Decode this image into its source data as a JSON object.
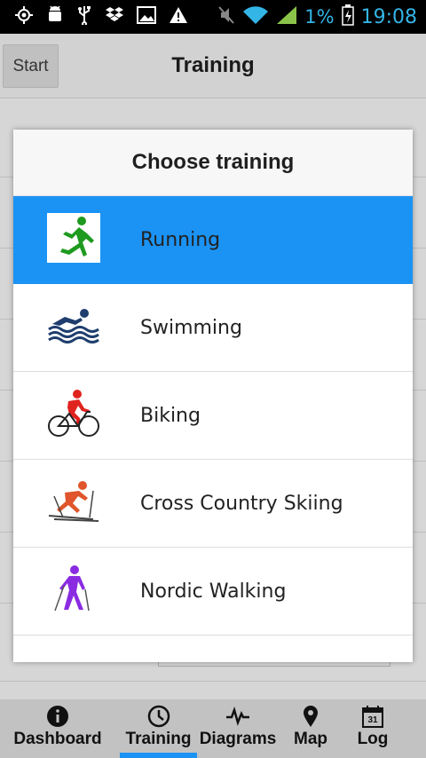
{
  "status_bar": {
    "battery_percent": "1%",
    "time": "19:08",
    "icons": [
      "gps-icon",
      "android-debug-icon",
      "usb-icon",
      "dropbox-icon",
      "image-icon",
      "warning-icon",
      "mute-icon",
      "wifi-icon",
      "signal-icon",
      "battery-icon"
    ]
  },
  "header": {
    "start_label": "Start",
    "title": "Training"
  },
  "dialog": {
    "title": "Choose training",
    "options": [
      {
        "label": "Running",
        "icon": "running-icon",
        "selected": true
      },
      {
        "label": "Swimming",
        "icon": "swimming-icon",
        "selected": false
      },
      {
        "label": "Biking",
        "icon": "biking-icon",
        "selected": false
      },
      {
        "label": "Cross Country Skiing",
        "icon": "skiing-icon",
        "selected": false
      },
      {
        "label": "Nordic Walking",
        "icon": "nordic-walking-icon",
        "selected": false
      }
    ]
  },
  "tabs": [
    {
      "label": "Dashboard",
      "icon": "info-icon",
      "active": false
    },
    {
      "label": "Training",
      "icon": "clock-icon",
      "active": true
    },
    {
      "label": "Diagrams",
      "icon": "pulse-icon",
      "active": false
    },
    {
      "label": "Map",
      "icon": "map-pin-icon",
      "active": false
    },
    {
      "label": "Log",
      "icon": "calendar-icon",
      "active": false
    }
  ],
  "log_icon_day": "31",
  "colors": {
    "accent": "#1b93f5",
    "status_text": "#33b5e5",
    "running": "#1e9a1e",
    "swimming": "#1f3e6e",
    "biking": "#e0231f",
    "skiing": "#e0552b",
    "walking": "#8a2be2"
  }
}
